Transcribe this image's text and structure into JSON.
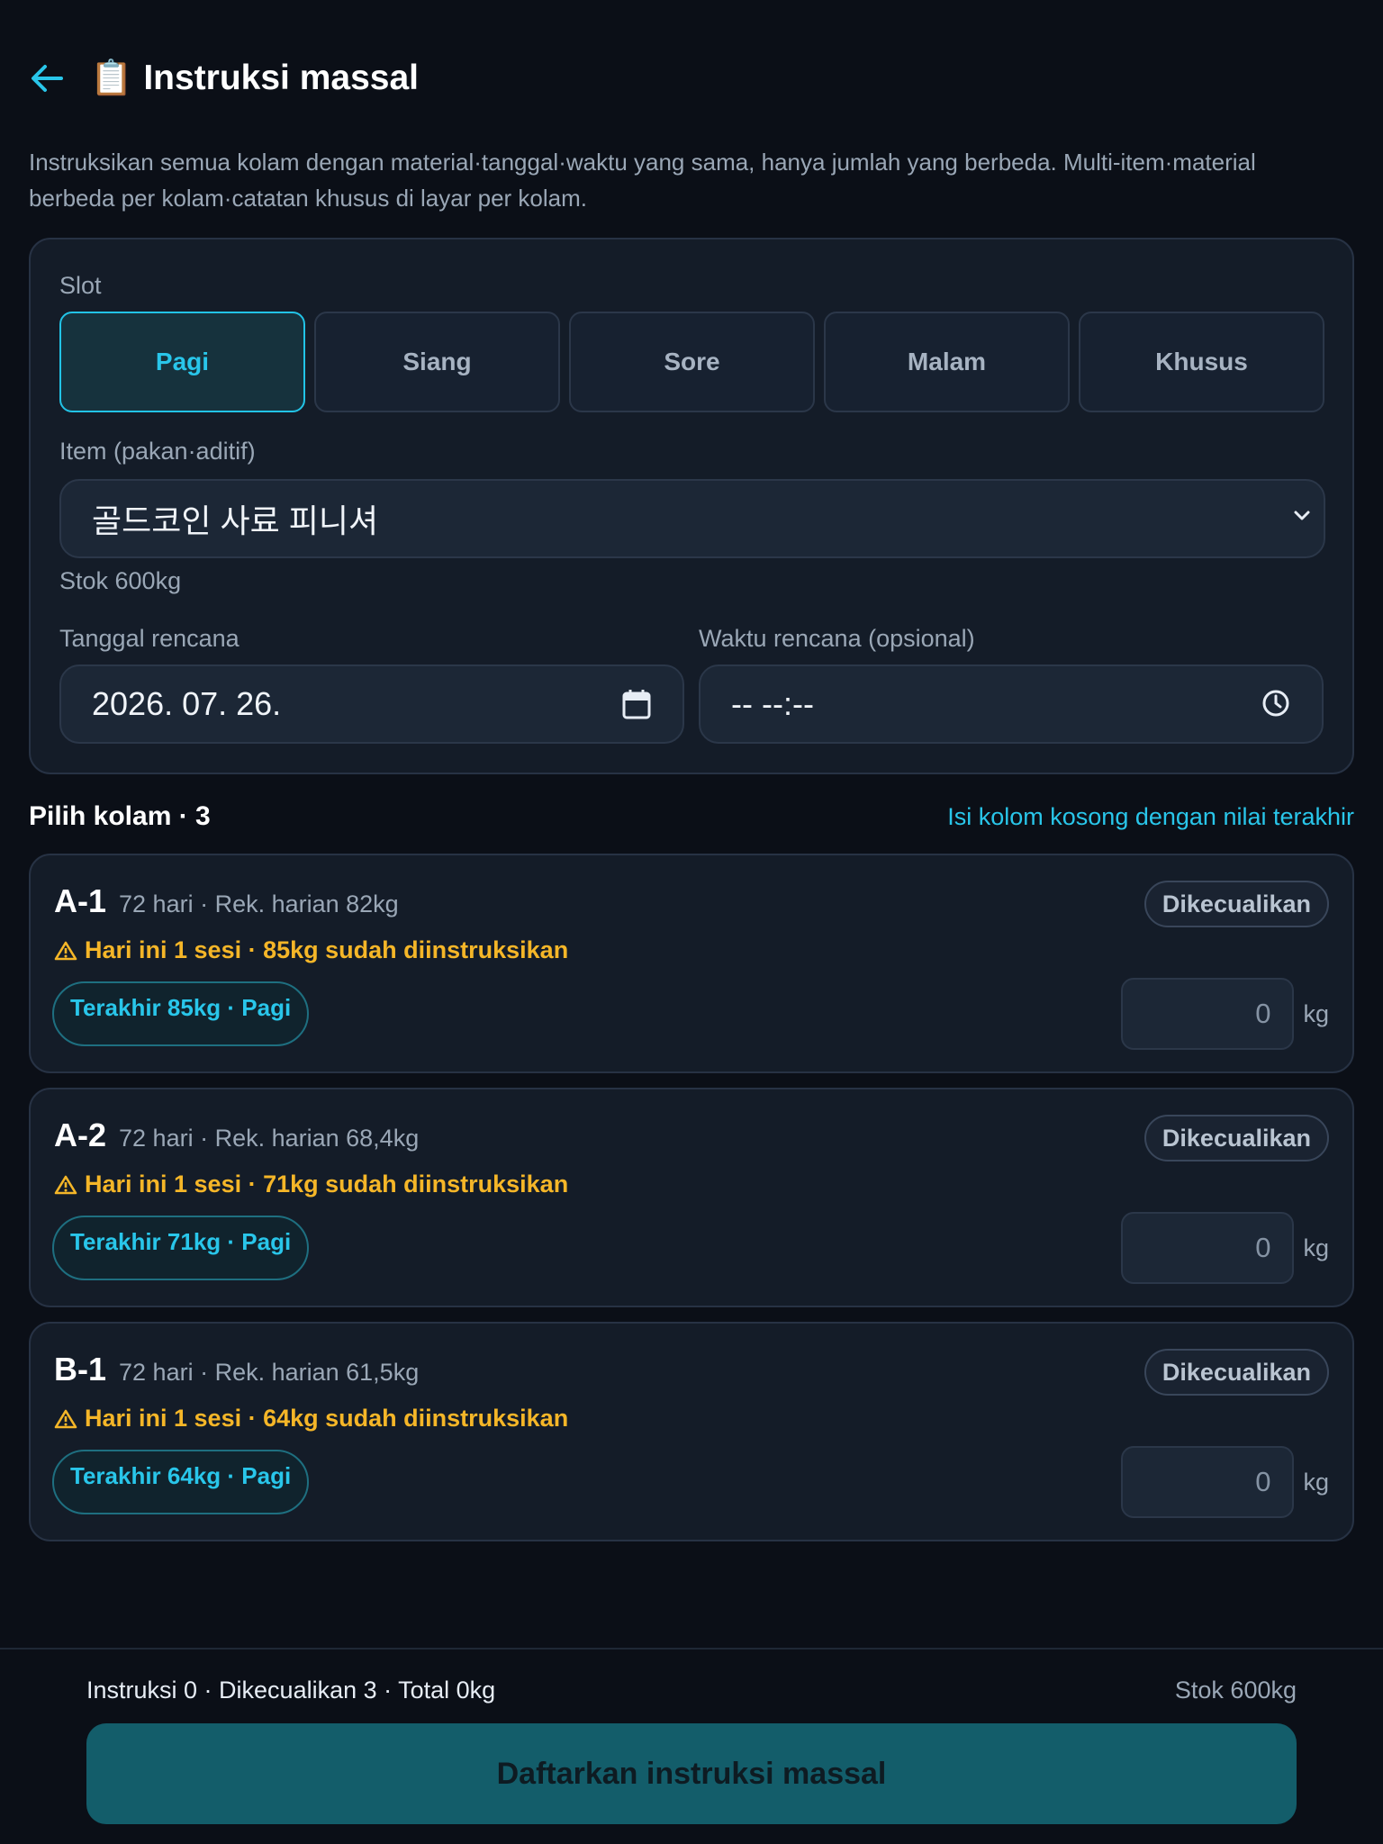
{
  "header": {
    "title_emoji": "📋",
    "title": "Instruksi massal"
  },
  "description": "Instruksikan semua kolam dengan material·tanggal·waktu yang sama, hanya jumlah yang berbeda. Multi-item·material berbeda per kolam·catatan khusus di layar per kolam.",
  "form": {
    "slot_label": "Slot",
    "slots": [
      "Pagi",
      "Siang",
      "Sore",
      "Malam",
      "Khusus"
    ],
    "active_slot": "Pagi",
    "item_label": "Item (pakan·aditif)",
    "item_value": "골드코인 사료 피니셔",
    "stock_note": "Stok 600kg",
    "date_label": "Tanggal rencana",
    "date_value": "2026. 07. 26.",
    "time_label": "Waktu rencana (opsional)",
    "time_value": "-- --:--"
  },
  "ponds_section": {
    "title": "Pilih kolam · 3",
    "fill_link": "Isi kolom kosong dengan nilai terakhir"
  },
  "ponds": [
    {
      "name": "A-1",
      "meta": "72 hari · Rek. harian 82kg",
      "status": "Dikecualikan",
      "warning": "Hari ini 1 sesi · 85kg sudah diinstruksikan",
      "last": "Terakhir 85kg · Pagi",
      "qty": "0",
      "unit": "kg"
    },
    {
      "name": "A-2",
      "meta": "72 hari · Rek. harian 68,4kg",
      "status": "Dikecualikan",
      "warning": "Hari ini 1 sesi · 71kg sudah diinstruksikan",
      "last": "Terakhir 71kg · Pagi",
      "qty": "0",
      "unit": "kg"
    },
    {
      "name": "B-1",
      "meta": "72 hari · Rek. harian 61,5kg",
      "status": "Dikecualikan",
      "warning": "Hari ini 1 sesi · 64kg sudah diinstruksikan",
      "last": "Terakhir 64kg · Pagi",
      "qty": "0",
      "unit": "kg"
    }
  ],
  "footer": {
    "summary": "Instruksi 0 · Dikecualikan 3 · Total 0kg",
    "stock": "Stok 600kg",
    "submit_label": "Daftarkan instruksi massal"
  },
  "colors": {
    "accent": "#29c6ea",
    "warning": "#f5b628",
    "background": "#0b0f17",
    "card": "#141c28",
    "submit": "#135d6a"
  },
  "icons": [
    "arrow-left-icon",
    "clipboard-icon",
    "chevron-down-icon",
    "calendar-icon",
    "clock-icon",
    "warning-icon"
  ]
}
